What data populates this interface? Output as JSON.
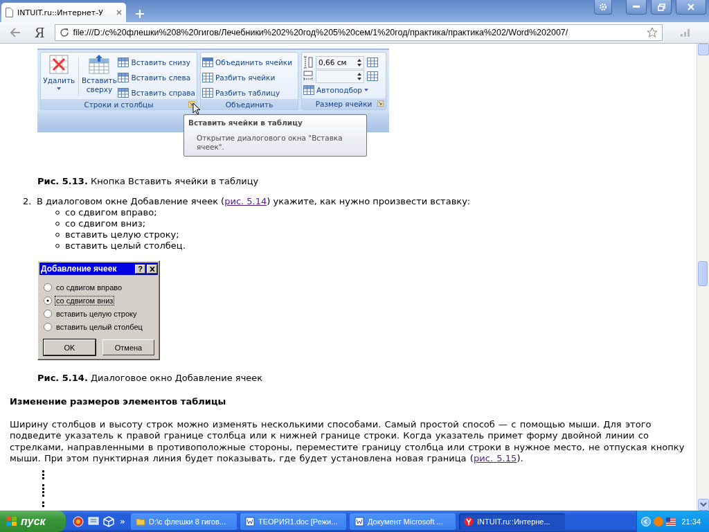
{
  "browser": {
    "tab_title": "INTUIT.ru::Интернет-У",
    "logo": "Я",
    "url": "file:///D:/c%20флешки%208%20гигов/Лечебники%202%20год%205%20сем/1%20год/практика/практика%202/Word%202007/"
  },
  "ribbon": {
    "rows_group": {
      "label": "Строки и столбцы",
      "delete": "Удалить",
      "insert_above": "Вставить сверху",
      "small_buttons": [
        "Вставить снизу",
        "Вставить слева",
        "Вставить справа"
      ]
    },
    "merge_group": {
      "label": "Объединить",
      "buttons": [
        "Объединить ячейки",
        "Разбить ячейки",
        "Разбить таблицу"
      ]
    },
    "size_group": {
      "label": "Размер ячейки",
      "height": "0,66 см",
      "autofit": "Автоподбор"
    }
  },
  "tooltip": {
    "title": "Вставить ячейки в таблицу",
    "description": "Открытие диалогового окна \"Вставка ячеек\"."
  },
  "caption_1": "**Рис. 5.13.**  Кнопка Вставить ячейки в таблицу",
  "list_item": {
    "number": "2.",
    "text_before": "В диалоговом окне Добавление ячеек (",
    "link": "рис. 5.14",
    "text_after": ") укажите, как нужно произвести вставку:",
    "bullets": [
      "со сдвигом вправо;",
      "со сдвигом вниз;",
      "вставить целую строку;",
      "вставить целый столбец."
    ]
  },
  "dialog": {
    "title": "Добавление ячеек",
    "help_button": "?",
    "options": [
      {
        "label": "со сдвигом вправо",
        "selected": false
      },
      {
        "label": "со сдвигом вниз",
        "selected": true
      },
      {
        "label": "вставить целую строку",
        "selected": false
      },
      {
        "label": "вставить целый столбец",
        "selected": false
      }
    ],
    "buttons": [
      "OK",
      "Отмена"
    ]
  },
  "caption_2": "**Рис. 5.14.**  Диалоговое окно Добавление ячеек",
  "heading": "Изменение размеров элементов таблицы",
  "paragraph": {
    "text": "Ширину столбцов и высоту строк можно изменять несколькими способами. Самый простой способ — с помощью мыши. Для этого подведите указатель к правой границе столбца или к нижней границе строки. Когда указатель примет форму двойной линии со стрелками, направленными в противоположные стороны, переместите границу столбца или строки в нужное место, не отпуская кнопку мыши. При этом пунктирная линия будет показывать, где будет установлена новая граница (",
    "link": "рис. 5.15",
    "text_after": ")."
  },
  "taskbar": {
    "start": "пуск",
    "more": "»",
    "tasks": [
      {
        "label": "D:\\c флешки 8 гигов...",
        "kind": "folder",
        "selected": false
      },
      {
        "label": "ТЕОРИЯ1.doc [Режи...",
        "kind": "word",
        "selected": false
      },
      {
        "label": "Документ Microsoft ...",
        "kind": "word",
        "selected": false
      },
      {
        "label": "INTUIT.ru::Интерне...",
        "kind": "browser",
        "selected": true
      }
    ],
    "clock": "21:34"
  }
}
